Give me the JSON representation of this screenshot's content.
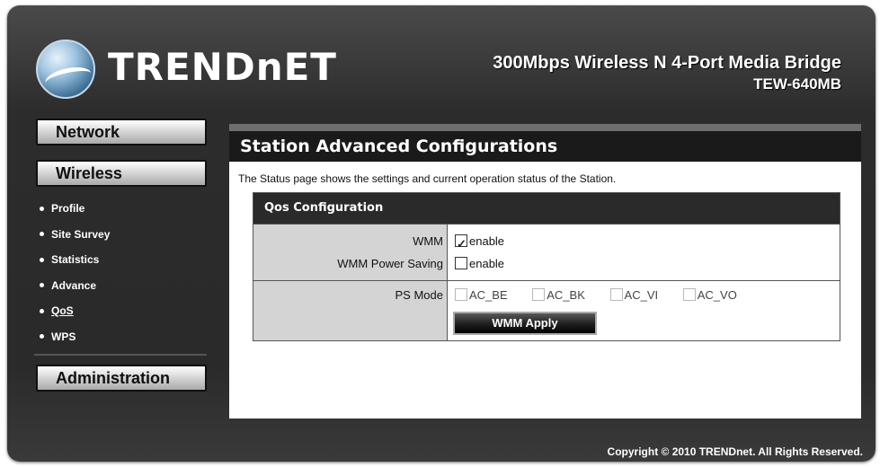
{
  "header": {
    "logo_text": "TRENDnET",
    "product_title": "300Mbps Wireless N 4-Port Media Bridge",
    "product_model": "TEW-640MB"
  },
  "sidebar": {
    "network_label": "Network",
    "wireless_label": "Wireless",
    "administration_label": "Administration",
    "items": [
      {
        "label": "Profile"
      },
      {
        "label": "Site Survey"
      },
      {
        "label": "Statistics"
      },
      {
        "label": "Advance"
      },
      {
        "label": "QoS"
      },
      {
        "label": "WPS"
      }
    ],
    "active_item": "QoS"
  },
  "main": {
    "title": "Station Advanced Configurations",
    "description": "The Status page shows the settings and current operation status of the Station.",
    "qos": {
      "header": "Qos Configuration",
      "wmm_label": "WMM",
      "wmm_enable_label": "enable",
      "wmm_enabled": true,
      "power_saving_label": "WMM Power Saving",
      "power_saving_enable_label": "enable",
      "power_saving_enabled": false,
      "ps_mode_label": "PS Mode",
      "ps_modes": [
        "AC_BE",
        "AC_BK",
        "AC_VI",
        "AC_VO"
      ],
      "apply_label": "WMM Apply"
    }
  },
  "footer": {
    "copyright": "Copyright © 2010 TRENDnet. All Rights Reserved."
  },
  "colors": {
    "frame": "#2c2c2c",
    "panel_header": "#1a1a1a",
    "label_cell": "#d4d4d4"
  }
}
